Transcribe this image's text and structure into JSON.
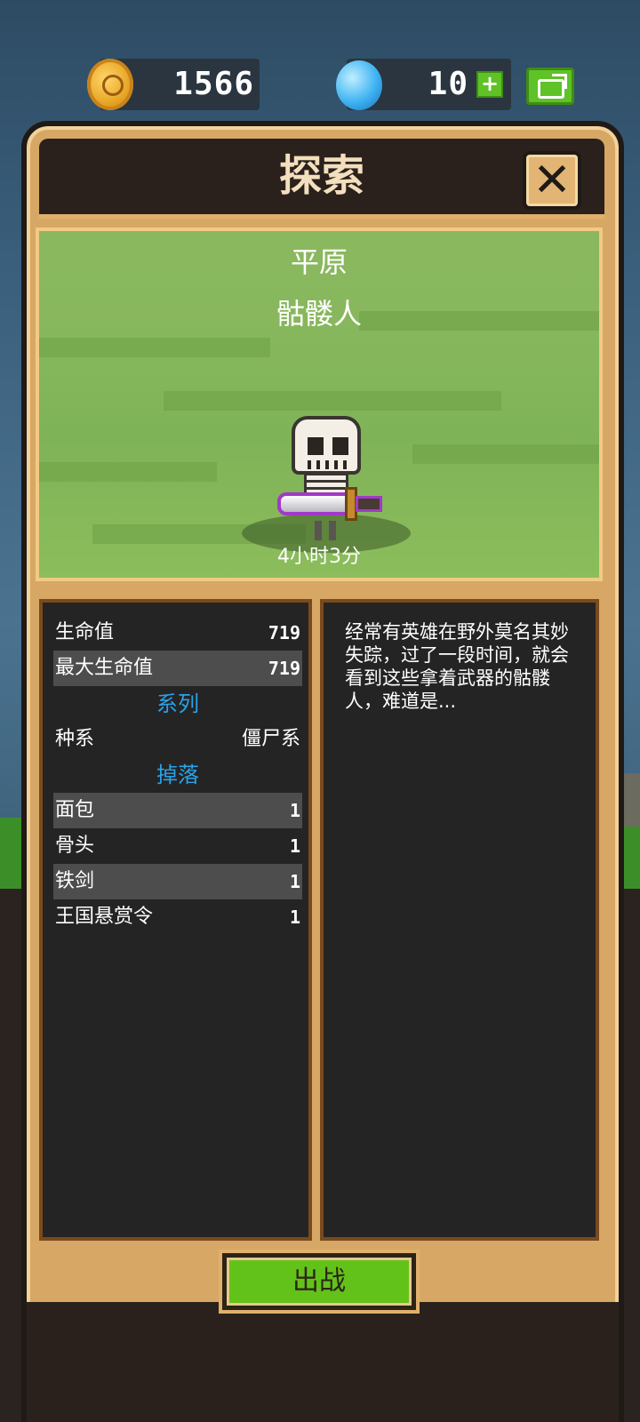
{
  "currency": {
    "coins": "1566",
    "gems": "10",
    "add_label": "+"
  },
  "dialog": {
    "title": "探索",
    "close_label": "✕"
  },
  "scene": {
    "region": "平原",
    "monster": "骷髅人",
    "timer": "4小时3分"
  },
  "stats": {
    "hp_label": "生命值",
    "hp_value": "719",
    "max_hp_label": "最大生命值",
    "max_hp_value": "719",
    "series_header": "系列",
    "race_label": "种系",
    "race_value": "僵尸系",
    "drops_header": "掉落",
    "drops": [
      {
        "name": "面包",
        "count": "1"
      },
      {
        "name": "骨头",
        "count": "1"
      },
      {
        "name": "铁剑",
        "count": "1"
      },
      {
        "name": "王国悬赏令",
        "count": "1"
      }
    ]
  },
  "description": "经常有英雄在野外莫名其妙失踪，过了一段时间，就会看到这些拿着武器的骷髅人，难道是...",
  "battle_label": "出战",
  "colors": {
    "accent_green": "#62c21a",
    "section_blue": "#2aa2e8",
    "frame_tan": "#d7a865"
  }
}
